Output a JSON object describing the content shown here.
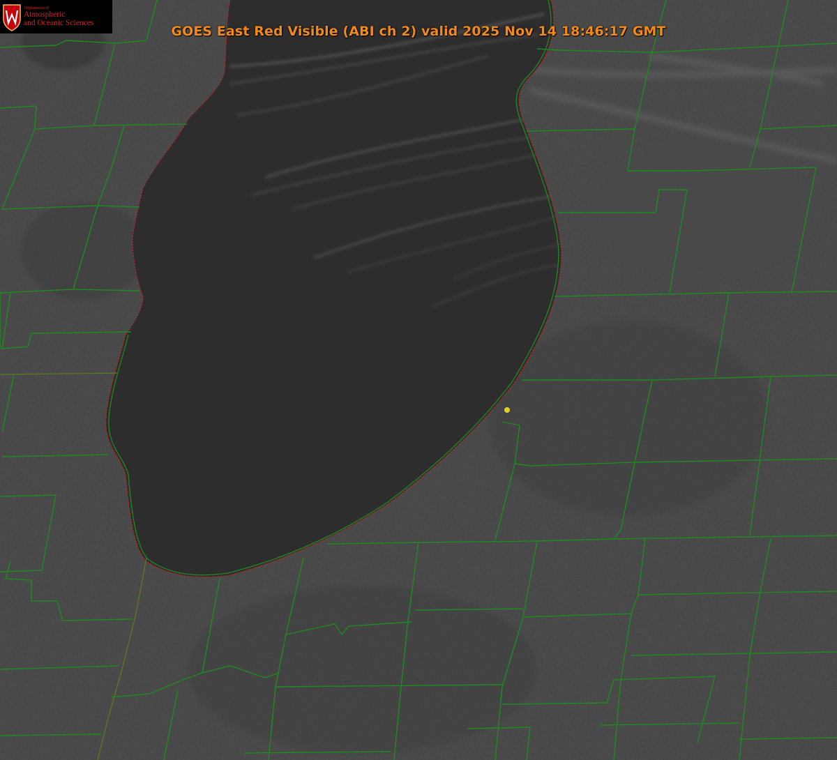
{
  "title": "GOES East Red Visible (ABI ch 2) valid 2025 Nov 14 18:46:17 GMT",
  "logo": {
    "department": "Department of",
    "line1": "Atmospheric",
    "line2": "and Oceanic Sciences",
    "crest_letter": "W",
    "crest_color": "#c5050c"
  },
  "colors": {
    "boundary": "#1f8a1f",
    "shoreline": "#cc2222",
    "lake": "#2c2c2c",
    "land": "#3f3f3f",
    "site_marker": "#e0d020",
    "title": "#f08a1c"
  }
}
